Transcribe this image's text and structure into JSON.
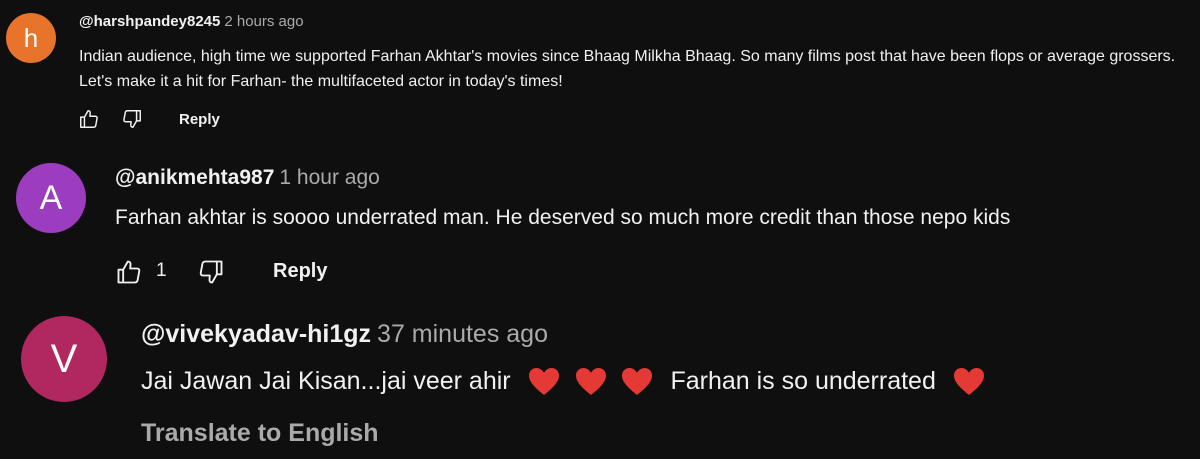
{
  "comments": [
    {
      "avatar_letter": "h",
      "avatar_color": "#e8732a",
      "handle": "@harshpandey8245",
      "time": "2 hours ago",
      "text": "Indian audience, high time we supported Farhan Akhtar's movies since Bhaag Milkha Bhaag. So many films post that have been flops or average grossers. Let's make it a hit for Farhan- the multifaceted actor in today's times!",
      "reply_label": "Reply",
      "icons": [
        "thumbs-up-icon",
        "thumbs-down-icon"
      ]
    },
    {
      "avatar_letter": "A",
      "avatar_color": "#9c3dbf",
      "handle": "@anikmehta987",
      "time": "1 hour ago",
      "text": "Farhan akhtar is soooo underrated man. He deserved so much more credit than those nepo kids",
      "like_count": "1",
      "reply_label": "Reply",
      "icons": [
        "thumbs-up-icon",
        "thumbs-down-icon"
      ]
    },
    {
      "avatar_letter": "V",
      "avatar_color": "#b0285f",
      "handle": "@vivekyadav-hi1gz",
      "time": "37 minutes ago",
      "text_part1": "Jai Jawan Jai Kisan...jai veer ahir",
      "text_part2": "Farhan is so underrated",
      "emoji": "heart-emoji",
      "emoji_color": "#e53935",
      "translate_label": "Translate to English"
    }
  ]
}
